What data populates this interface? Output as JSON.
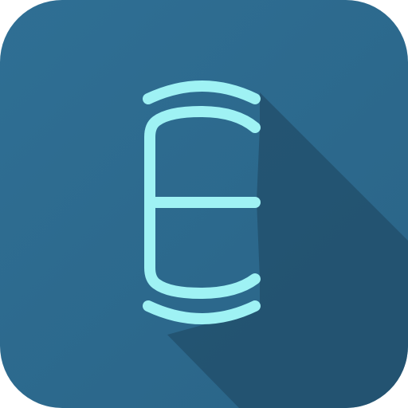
{
  "icon": {
    "name": "stylized-letter-e-app-icon",
    "glyph_icon": "letter-e-bracket-icon",
    "colors": {
      "background_top": "#2f6f94",
      "background_bottom": "#2a6487",
      "long_shadow": "#214e6a",
      "glyph": "#9ff2f4"
    }
  }
}
